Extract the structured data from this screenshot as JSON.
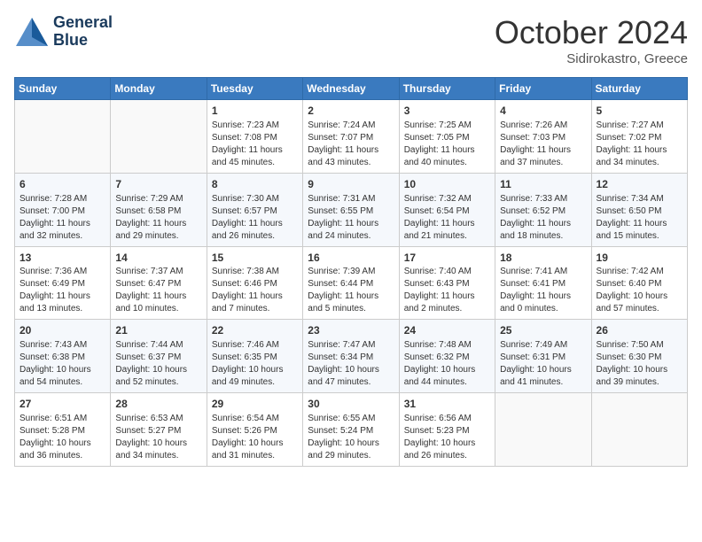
{
  "header": {
    "logo_line1": "General",
    "logo_line2": "Blue",
    "month": "October 2024",
    "location": "Sidirokastro, Greece"
  },
  "weekdays": [
    "Sunday",
    "Monday",
    "Tuesday",
    "Wednesday",
    "Thursday",
    "Friday",
    "Saturday"
  ],
  "weeks": [
    [
      {
        "day": "",
        "info": ""
      },
      {
        "day": "",
        "info": ""
      },
      {
        "day": "1",
        "info": "Sunrise: 7:23 AM\nSunset: 7:08 PM\nDaylight: 11 hours and 45 minutes."
      },
      {
        "day": "2",
        "info": "Sunrise: 7:24 AM\nSunset: 7:07 PM\nDaylight: 11 hours and 43 minutes."
      },
      {
        "day": "3",
        "info": "Sunrise: 7:25 AM\nSunset: 7:05 PM\nDaylight: 11 hours and 40 minutes."
      },
      {
        "day": "4",
        "info": "Sunrise: 7:26 AM\nSunset: 7:03 PM\nDaylight: 11 hours and 37 minutes."
      },
      {
        "day": "5",
        "info": "Sunrise: 7:27 AM\nSunset: 7:02 PM\nDaylight: 11 hours and 34 minutes."
      }
    ],
    [
      {
        "day": "6",
        "info": "Sunrise: 7:28 AM\nSunset: 7:00 PM\nDaylight: 11 hours and 32 minutes."
      },
      {
        "day": "7",
        "info": "Sunrise: 7:29 AM\nSunset: 6:58 PM\nDaylight: 11 hours and 29 minutes."
      },
      {
        "day": "8",
        "info": "Sunrise: 7:30 AM\nSunset: 6:57 PM\nDaylight: 11 hours and 26 minutes."
      },
      {
        "day": "9",
        "info": "Sunrise: 7:31 AM\nSunset: 6:55 PM\nDaylight: 11 hours and 24 minutes."
      },
      {
        "day": "10",
        "info": "Sunrise: 7:32 AM\nSunset: 6:54 PM\nDaylight: 11 hours and 21 minutes."
      },
      {
        "day": "11",
        "info": "Sunrise: 7:33 AM\nSunset: 6:52 PM\nDaylight: 11 hours and 18 minutes."
      },
      {
        "day": "12",
        "info": "Sunrise: 7:34 AM\nSunset: 6:50 PM\nDaylight: 11 hours and 15 minutes."
      }
    ],
    [
      {
        "day": "13",
        "info": "Sunrise: 7:36 AM\nSunset: 6:49 PM\nDaylight: 11 hours and 13 minutes."
      },
      {
        "day": "14",
        "info": "Sunrise: 7:37 AM\nSunset: 6:47 PM\nDaylight: 11 hours and 10 minutes."
      },
      {
        "day": "15",
        "info": "Sunrise: 7:38 AM\nSunset: 6:46 PM\nDaylight: 11 hours and 7 minutes."
      },
      {
        "day": "16",
        "info": "Sunrise: 7:39 AM\nSunset: 6:44 PM\nDaylight: 11 hours and 5 minutes."
      },
      {
        "day": "17",
        "info": "Sunrise: 7:40 AM\nSunset: 6:43 PM\nDaylight: 11 hours and 2 minutes."
      },
      {
        "day": "18",
        "info": "Sunrise: 7:41 AM\nSunset: 6:41 PM\nDaylight: 11 hours and 0 minutes."
      },
      {
        "day": "19",
        "info": "Sunrise: 7:42 AM\nSunset: 6:40 PM\nDaylight: 10 hours and 57 minutes."
      }
    ],
    [
      {
        "day": "20",
        "info": "Sunrise: 7:43 AM\nSunset: 6:38 PM\nDaylight: 10 hours and 54 minutes."
      },
      {
        "day": "21",
        "info": "Sunrise: 7:44 AM\nSunset: 6:37 PM\nDaylight: 10 hours and 52 minutes."
      },
      {
        "day": "22",
        "info": "Sunrise: 7:46 AM\nSunset: 6:35 PM\nDaylight: 10 hours and 49 minutes."
      },
      {
        "day": "23",
        "info": "Sunrise: 7:47 AM\nSunset: 6:34 PM\nDaylight: 10 hours and 47 minutes."
      },
      {
        "day": "24",
        "info": "Sunrise: 7:48 AM\nSunset: 6:32 PM\nDaylight: 10 hours and 44 minutes."
      },
      {
        "day": "25",
        "info": "Sunrise: 7:49 AM\nSunset: 6:31 PM\nDaylight: 10 hours and 41 minutes."
      },
      {
        "day": "26",
        "info": "Sunrise: 7:50 AM\nSunset: 6:30 PM\nDaylight: 10 hours and 39 minutes."
      }
    ],
    [
      {
        "day": "27",
        "info": "Sunrise: 6:51 AM\nSunset: 5:28 PM\nDaylight: 10 hours and 36 minutes."
      },
      {
        "day": "28",
        "info": "Sunrise: 6:53 AM\nSunset: 5:27 PM\nDaylight: 10 hours and 34 minutes."
      },
      {
        "day": "29",
        "info": "Sunrise: 6:54 AM\nSunset: 5:26 PM\nDaylight: 10 hours and 31 minutes."
      },
      {
        "day": "30",
        "info": "Sunrise: 6:55 AM\nSunset: 5:24 PM\nDaylight: 10 hours and 29 minutes."
      },
      {
        "day": "31",
        "info": "Sunrise: 6:56 AM\nSunset: 5:23 PM\nDaylight: 10 hours and 26 minutes."
      },
      {
        "day": "",
        "info": ""
      },
      {
        "day": "",
        "info": ""
      }
    ]
  ]
}
